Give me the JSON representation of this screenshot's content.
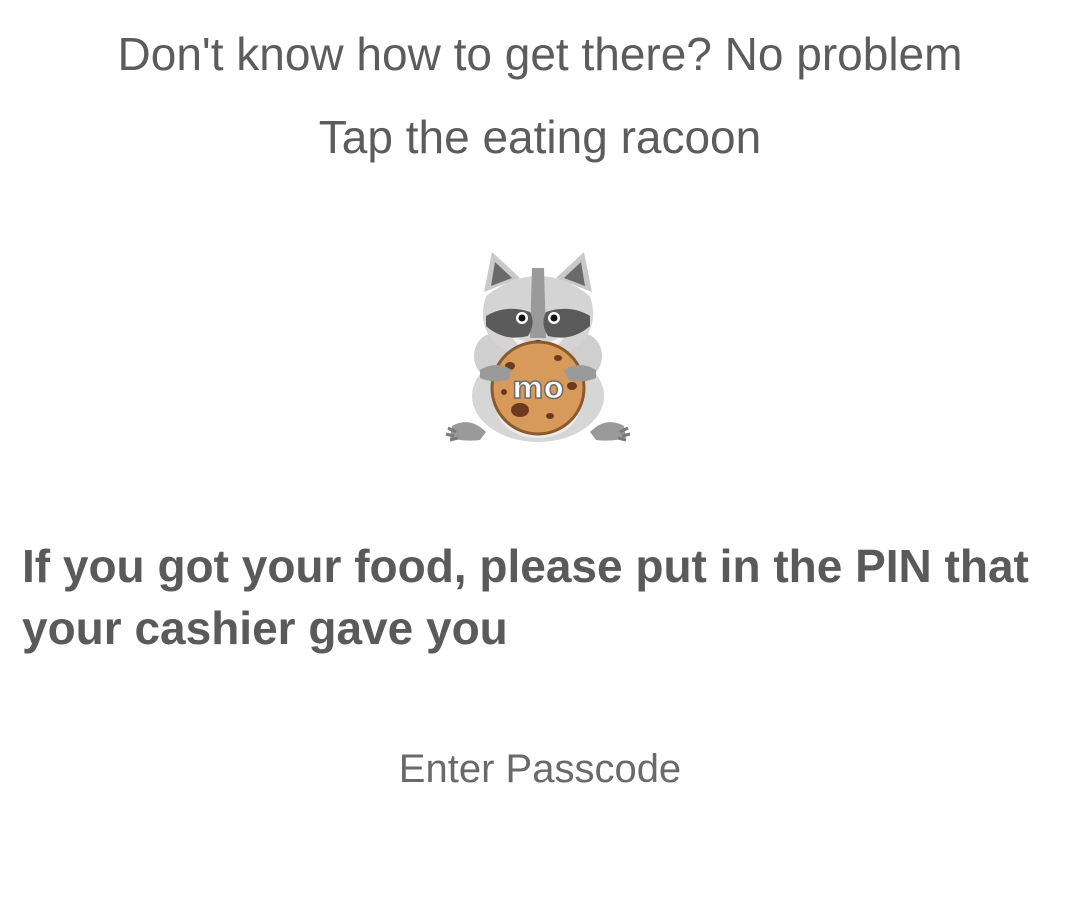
{
  "header": {
    "line1": "Don't know how to get there? No problem",
    "line2": "Tap the eating racoon"
  },
  "racoon": {
    "icon": "racoon-eating-cookie-icon",
    "cookie_text": "mo"
  },
  "pin_prompt": {
    "text": "If you got your food, please put in the PIN that your cashier gave you"
  },
  "passcode": {
    "placeholder": "Enter Passcode",
    "value": ""
  },
  "colors": {
    "text": "#5c5c5c",
    "background": "#ffffff",
    "cookie": "#d89a5b",
    "fur": "#cfcfcf",
    "mask": "#5a5a5a"
  }
}
